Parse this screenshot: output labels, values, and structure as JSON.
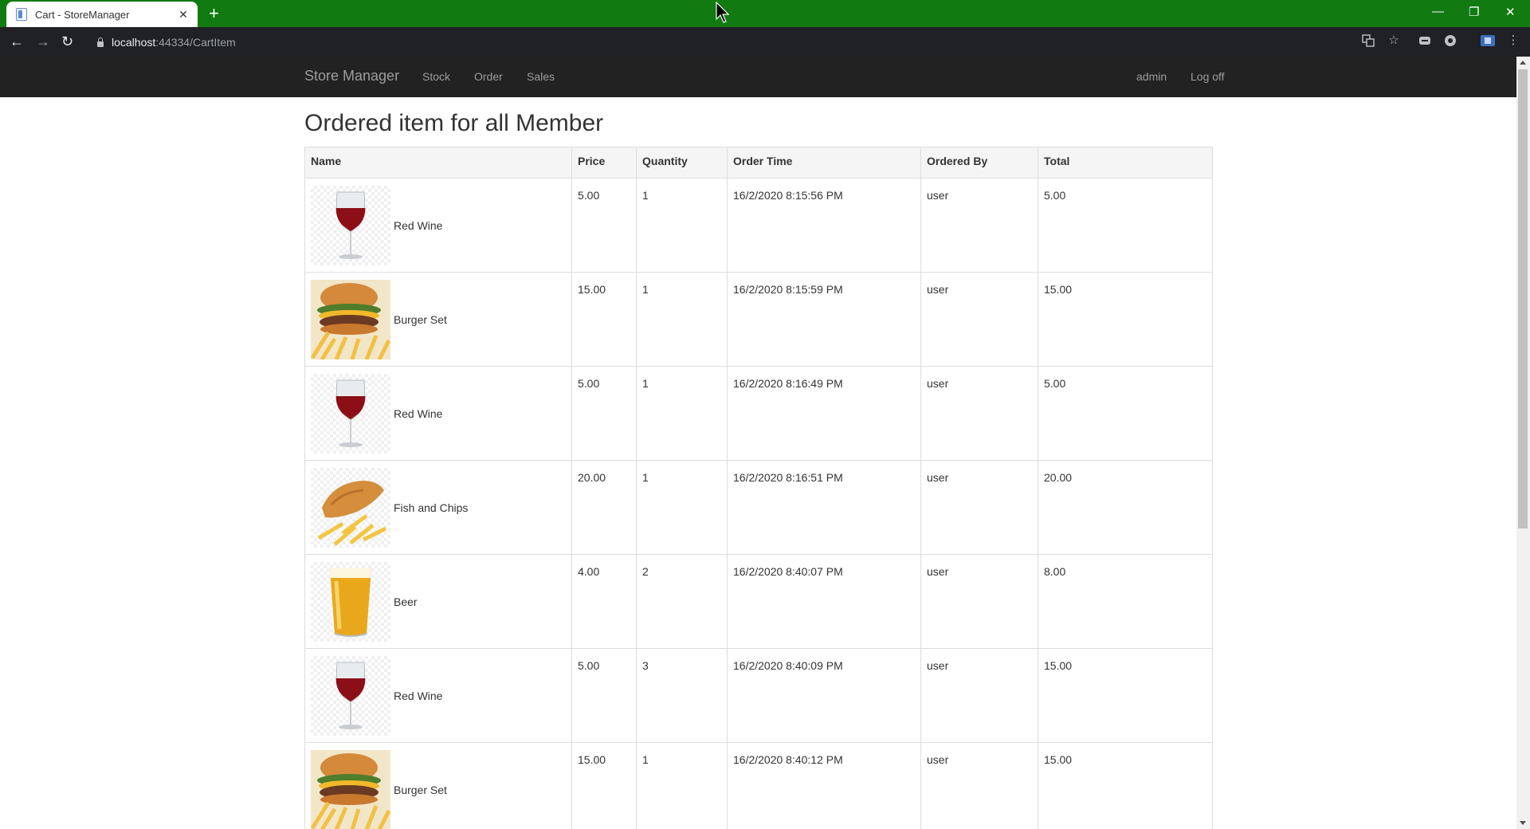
{
  "browser": {
    "tab_title": "Cart - StoreManager",
    "tab_close": "✕",
    "new_tab": "+",
    "url_host": "localhost",
    "url_path": ":44334/CartItem",
    "back": "←",
    "forward": "→",
    "reload": "↻",
    "minimize": "—",
    "restore": "❐",
    "close": "✕"
  },
  "navbar": {
    "brand": "Store Manager",
    "links": [
      "Stock",
      "Order",
      "Sales"
    ],
    "user": "admin",
    "logoff": "Log off"
  },
  "page": {
    "title": "Ordered item for all Member"
  },
  "table": {
    "headers": [
      "Name",
      "Price",
      "Quantity",
      "Order Time",
      "Ordered By",
      "Total"
    ],
    "rows": [
      {
        "name": "Red Wine",
        "image": "red-wine",
        "price": "5.00",
        "quantity": "1",
        "order_time": "16/2/2020 8:15:56 PM",
        "ordered_by": "user",
        "total": "5.00"
      },
      {
        "name": "Burger Set",
        "image": "burger",
        "price": "15.00",
        "quantity": "1",
        "order_time": "16/2/2020 8:15:59 PM",
        "ordered_by": "user",
        "total": "15.00"
      },
      {
        "name": "Red Wine",
        "image": "red-wine",
        "price": "5.00",
        "quantity": "1",
        "order_time": "16/2/2020 8:16:49 PM",
        "ordered_by": "user",
        "total": "5.00"
      },
      {
        "name": "Fish and Chips",
        "image": "fish-chips",
        "price": "20.00",
        "quantity": "1",
        "order_time": "16/2/2020 8:16:51 PM",
        "ordered_by": "user",
        "total": "20.00"
      },
      {
        "name": "Beer",
        "image": "beer",
        "price": "4.00",
        "quantity": "2",
        "order_time": "16/2/2020 8:40:07 PM",
        "ordered_by": "user",
        "total": "8.00"
      },
      {
        "name": "Red Wine",
        "image": "red-wine",
        "price": "5.00",
        "quantity": "3",
        "order_time": "16/2/2020 8:40:09 PM",
        "ordered_by": "user",
        "total": "15.00"
      },
      {
        "name": "Burger Set",
        "image": "burger",
        "price": "15.00",
        "quantity": "1",
        "order_time": "16/2/2020 8:40:12 PM",
        "ordered_by": "user",
        "total": "15.00"
      }
    ]
  },
  "colors": {
    "tabbar": "#117a11",
    "navbar": "#222222",
    "nav_text": "#9d9d9d"
  }
}
